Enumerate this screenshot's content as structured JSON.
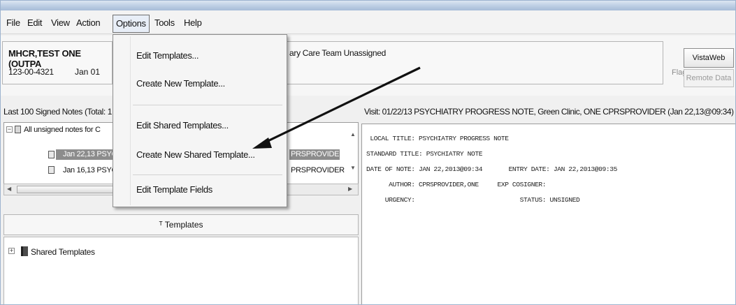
{
  "menubar": [
    "File",
    "Edit",
    "View",
    "Action",
    "Options",
    "Tools",
    "Help"
  ],
  "patient": {
    "name": "MHCR,TEST ONE (OUTPA",
    "id": "123-00-4321",
    "date": "Jan 01",
    "pc_team": "ary Care Team Unassigned"
  },
  "header_right": {
    "flag": "Flag",
    "vistaweb": "VistaWeb",
    "remote": "Remote Data"
  },
  "notes_panel": {
    "caption": "Last 100 Signed Notes (Total: 1",
    "tree": {
      "root": "All unsigned notes for C",
      "row1": "Jan 22,13 PSYC",
      "row1_right": "PRSPROVIDER",
      "row2": "Jan 16,13 PSYC",
      "row2_right": "PRSPROVIDER"
    }
  },
  "templates": {
    "header": "Templates",
    "shared": "Shared Templates"
  },
  "note": {
    "visit_line": "Visit: 01/22/13  PSYCHIATRY PROGRESS NOTE, Green Clinic, ONE CPRSPROVIDER  (Jan 22,13@09:34)",
    "body": " LOCAL TITLE: PSYCHIATRY PROGRESS NOTE\nSTANDARD TITLE: PSYCHIATRY NOTE\nDATE OF NOTE: JAN 22,2013@09:34       ENTRY DATE: JAN 22,2013@09:35\n      AUTHOR: CPRSPROVIDER,ONE     EXP COSIGNER:\n     URGENCY:                            STATUS: UNSIGNED"
  },
  "options_menu": {
    "edit_templates": "Edit Templates...",
    "create_new_template": "Create New Template...",
    "edit_shared_templates": "Edit Shared Templates...",
    "create_new_shared_template": "Create New Shared Template...",
    "edit_template_fields": "Edit Template Fields"
  },
  "colors": {
    "selection": "#8c8c8c",
    "title_strip": "#b9cbe2",
    "arrow": "#111111"
  },
  "icons": [
    "expand-icon",
    "tree-root-icon",
    "note-icon",
    "book-icon",
    "scroll-arrow-icon"
  ]
}
